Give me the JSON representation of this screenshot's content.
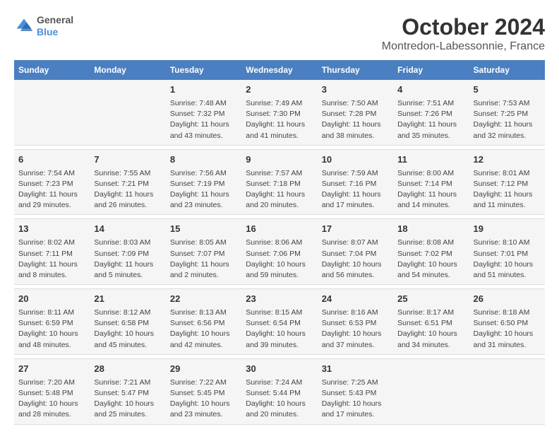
{
  "logo": {
    "line1": "General",
    "line2": "Blue"
  },
  "title": "October 2024",
  "subtitle": "Montredon-Labessonnie, France",
  "days_of_week": [
    "Sunday",
    "Monday",
    "Tuesday",
    "Wednesday",
    "Thursday",
    "Friday",
    "Saturday"
  ],
  "weeks": [
    [
      {
        "num": "",
        "sunrise": "",
        "sunset": "",
        "daylight": ""
      },
      {
        "num": "",
        "sunrise": "",
        "sunset": "",
        "daylight": ""
      },
      {
        "num": "1",
        "sunrise": "Sunrise: 7:48 AM",
        "sunset": "Sunset: 7:32 PM",
        "daylight": "Daylight: 11 hours and 43 minutes."
      },
      {
        "num": "2",
        "sunrise": "Sunrise: 7:49 AM",
        "sunset": "Sunset: 7:30 PM",
        "daylight": "Daylight: 11 hours and 41 minutes."
      },
      {
        "num": "3",
        "sunrise": "Sunrise: 7:50 AM",
        "sunset": "Sunset: 7:28 PM",
        "daylight": "Daylight: 11 hours and 38 minutes."
      },
      {
        "num": "4",
        "sunrise": "Sunrise: 7:51 AM",
        "sunset": "Sunset: 7:26 PM",
        "daylight": "Daylight: 11 hours and 35 minutes."
      },
      {
        "num": "5",
        "sunrise": "Sunrise: 7:53 AM",
        "sunset": "Sunset: 7:25 PM",
        "daylight": "Daylight: 11 hours and 32 minutes."
      }
    ],
    [
      {
        "num": "6",
        "sunrise": "Sunrise: 7:54 AM",
        "sunset": "Sunset: 7:23 PM",
        "daylight": "Daylight: 11 hours and 29 minutes."
      },
      {
        "num": "7",
        "sunrise": "Sunrise: 7:55 AM",
        "sunset": "Sunset: 7:21 PM",
        "daylight": "Daylight: 11 hours and 26 minutes."
      },
      {
        "num": "8",
        "sunrise": "Sunrise: 7:56 AM",
        "sunset": "Sunset: 7:19 PM",
        "daylight": "Daylight: 11 hours and 23 minutes."
      },
      {
        "num": "9",
        "sunrise": "Sunrise: 7:57 AM",
        "sunset": "Sunset: 7:18 PM",
        "daylight": "Daylight: 11 hours and 20 minutes."
      },
      {
        "num": "10",
        "sunrise": "Sunrise: 7:59 AM",
        "sunset": "Sunset: 7:16 PM",
        "daylight": "Daylight: 11 hours and 17 minutes."
      },
      {
        "num": "11",
        "sunrise": "Sunrise: 8:00 AM",
        "sunset": "Sunset: 7:14 PM",
        "daylight": "Daylight: 11 hours and 14 minutes."
      },
      {
        "num": "12",
        "sunrise": "Sunrise: 8:01 AM",
        "sunset": "Sunset: 7:12 PM",
        "daylight": "Daylight: 11 hours and 11 minutes."
      }
    ],
    [
      {
        "num": "13",
        "sunrise": "Sunrise: 8:02 AM",
        "sunset": "Sunset: 7:11 PM",
        "daylight": "Daylight: 11 hours and 8 minutes."
      },
      {
        "num": "14",
        "sunrise": "Sunrise: 8:03 AM",
        "sunset": "Sunset: 7:09 PM",
        "daylight": "Daylight: 11 hours and 5 minutes."
      },
      {
        "num": "15",
        "sunrise": "Sunrise: 8:05 AM",
        "sunset": "Sunset: 7:07 PM",
        "daylight": "Daylight: 11 hours and 2 minutes."
      },
      {
        "num": "16",
        "sunrise": "Sunrise: 8:06 AM",
        "sunset": "Sunset: 7:06 PM",
        "daylight": "Daylight: 10 hours and 59 minutes."
      },
      {
        "num": "17",
        "sunrise": "Sunrise: 8:07 AM",
        "sunset": "Sunset: 7:04 PM",
        "daylight": "Daylight: 10 hours and 56 minutes."
      },
      {
        "num": "18",
        "sunrise": "Sunrise: 8:08 AM",
        "sunset": "Sunset: 7:02 PM",
        "daylight": "Daylight: 10 hours and 54 minutes."
      },
      {
        "num": "19",
        "sunrise": "Sunrise: 8:10 AM",
        "sunset": "Sunset: 7:01 PM",
        "daylight": "Daylight: 10 hours and 51 minutes."
      }
    ],
    [
      {
        "num": "20",
        "sunrise": "Sunrise: 8:11 AM",
        "sunset": "Sunset: 6:59 PM",
        "daylight": "Daylight: 10 hours and 48 minutes."
      },
      {
        "num": "21",
        "sunrise": "Sunrise: 8:12 AM",
        "sunset": "Sunset: 6:58 PM",
        "daylight": "Daylight: 10 hours and 45 minutes."
      },
      {
        "num": "22",
        "sunrise": "Sunrise: 8:13 AM",
        "sunset": "Sunset: 6:56 PM",
        "daylight": "Daylight: 10 hours and 42 minutes."
      },
      {
        "num": "23",
        "sunrise": "Sunrise: 8:15 AM",
        "sunset": "Sunset: 6:54 PM",
        "daylight": "Daylight: 10 hours and 39 minutes."
      },
      {
        "num": "24",
        "sunrise": "Sunrise: 8:16 AM",
        "sunset": "Sunset: 6:53 PM",
        "daylight": "Daylight: 10 hours and 37 minutes."
      },
      {
        "num": "25",
        "sunrise": "Sunrise: 8:17 AM",
        "sunset": "Sunset: 6:51 PM",
        "daylight": "Daylight: 10 hours and 34 minutes."
      },
      {
        "num": "26",
        "sunrise": "Sunrise: 8:18 AM",
        "sunset": "Sunset: 6:50 PM",
        "daylight": "Daylight: 10 hours and 31 minutes."
      }
    ],
    [
      {
        "num": "27",
        "sunrise": "Sunrise: 7:20 AM",
        "sunset": "Sunset: 5:48 PM",
        "daylight": "Daylight: 10 hours and 28 minutes."
      },
      {
        "num": "28",
        "sunrise": "Sunrise: 7:21 AM",
        "sunset": "Sunset: 5:47 PM",
        "daylight": "Daylight: 10 hours and 25 minutes."
      },
      {
        "num": "29",
        "sunrise": "Sunrise: 7:22 AM",
        "sunset": "Sunset: 5:45 PM",
        "daylight": "Daylight: 10 hours and 23 minutes."
      },
      {
        "num": "30",
        "sunrise": "Sunrise: 7:24 AM",
        "sunset": "Sunset: 5:44 PM",
        "daylight": "Daylight: 10 hours and 20 minutes."
      },
      {
        "num": "31",
        "sunrise": "Sunrise: 7:25 AM",
        "sunset": "Sunset: 5:43 PM",
        "daylight": "Daylight: 10 hours and 17 minutes."
      },
      {
        "num": "",
        "sunrise": "",
        "sunset": "",
        "daylight": ""
      },
      {
        "num": "",
        "sunrise": "",
        "sunset": "",
        "daylight": ""
      }
    ]
  ]
}
